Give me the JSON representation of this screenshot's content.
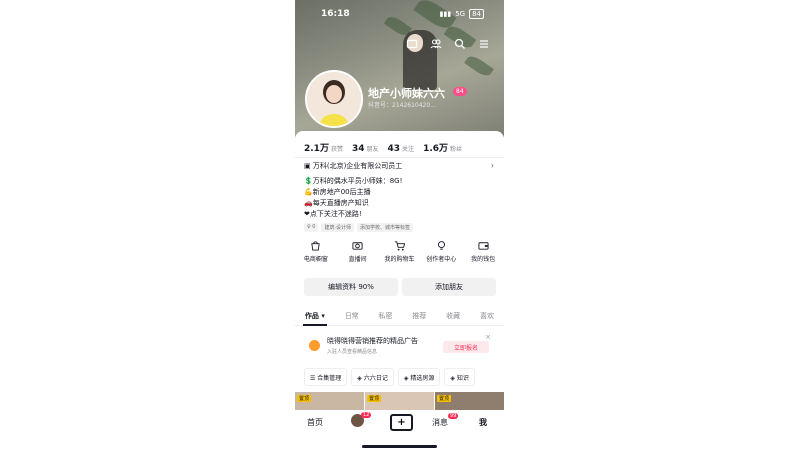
{
  "status_bar": {
    "time": "16:18",
    "network": "5G",
    "battery": "84"
  },
  "profile": {
    "name": "地产小师妹六六",
    "age_badge": "84",
    "douyin_id": "抖音号：2142610420..."
  },
  "stats": [
    {
      "value": "2.1万",
      "label": "获赞"
    },
    {
      "value": "34",
      "label": "朋友"
    },
    {
      "value": "43",
      "label": "关注"
    },
    {
      "value": "1.6万",
      "label": "粉丝"
    }
  ],
  "company": "万科(北京)企业有限公司员工",
  "bio_lines": [
    "万科的偶水平员小师妹：8G!",
    "新房地产00后主播",
    "每天直播房产知识",
    "点下关注不迷路!"
  ],
  "tags": [
    "♀ 0",
    "建筑·设计师",
    "添加学校、城市等标签"
  ],
  "services": [
    {
      "label": "电商橱窗",
      "icon": "shopping-bag-icon"
    },
    {
      "label": "直播间",
      "icon": "camera-icon"
    },
    {
      "label": "我的购物车",
      "icon": "cart-icon"
    },
    {
      "label": "创作者中心",
      "icon": "lightbulb-icon"
    },
    {
      "label": "我的钱包",
      "icon": "wallet-icon"
    }
  ],
  "buttons": {
    "edit": "编辑资料 90%",
    "add_friend": "添加朋友"
  },
  "tabs": [
    "作品 ▾",
    "日常",
    "私密",
    "推荐",
    "收藏",
    "喜欢"
  ],
  "promo": {
    "title": "晓得晓得营销推荐的精品广告",
    "subtitle": "入驻人员查看精品信息",
    "join": "立即报名",
    "close": "×"
  },
  "chips": [
    "☰ 合集管理",
    "◈ 六六日记",
    "◈ 精选房源",
    "◈ 知识"
  ],
  "thumb_badge": "置顶",
  "bottom_nav": {
    "home": "首页",
    "friends_badge": "12",
    "message": "消息",
    "message_badge": "99",
    "me": "我"
  }
}
